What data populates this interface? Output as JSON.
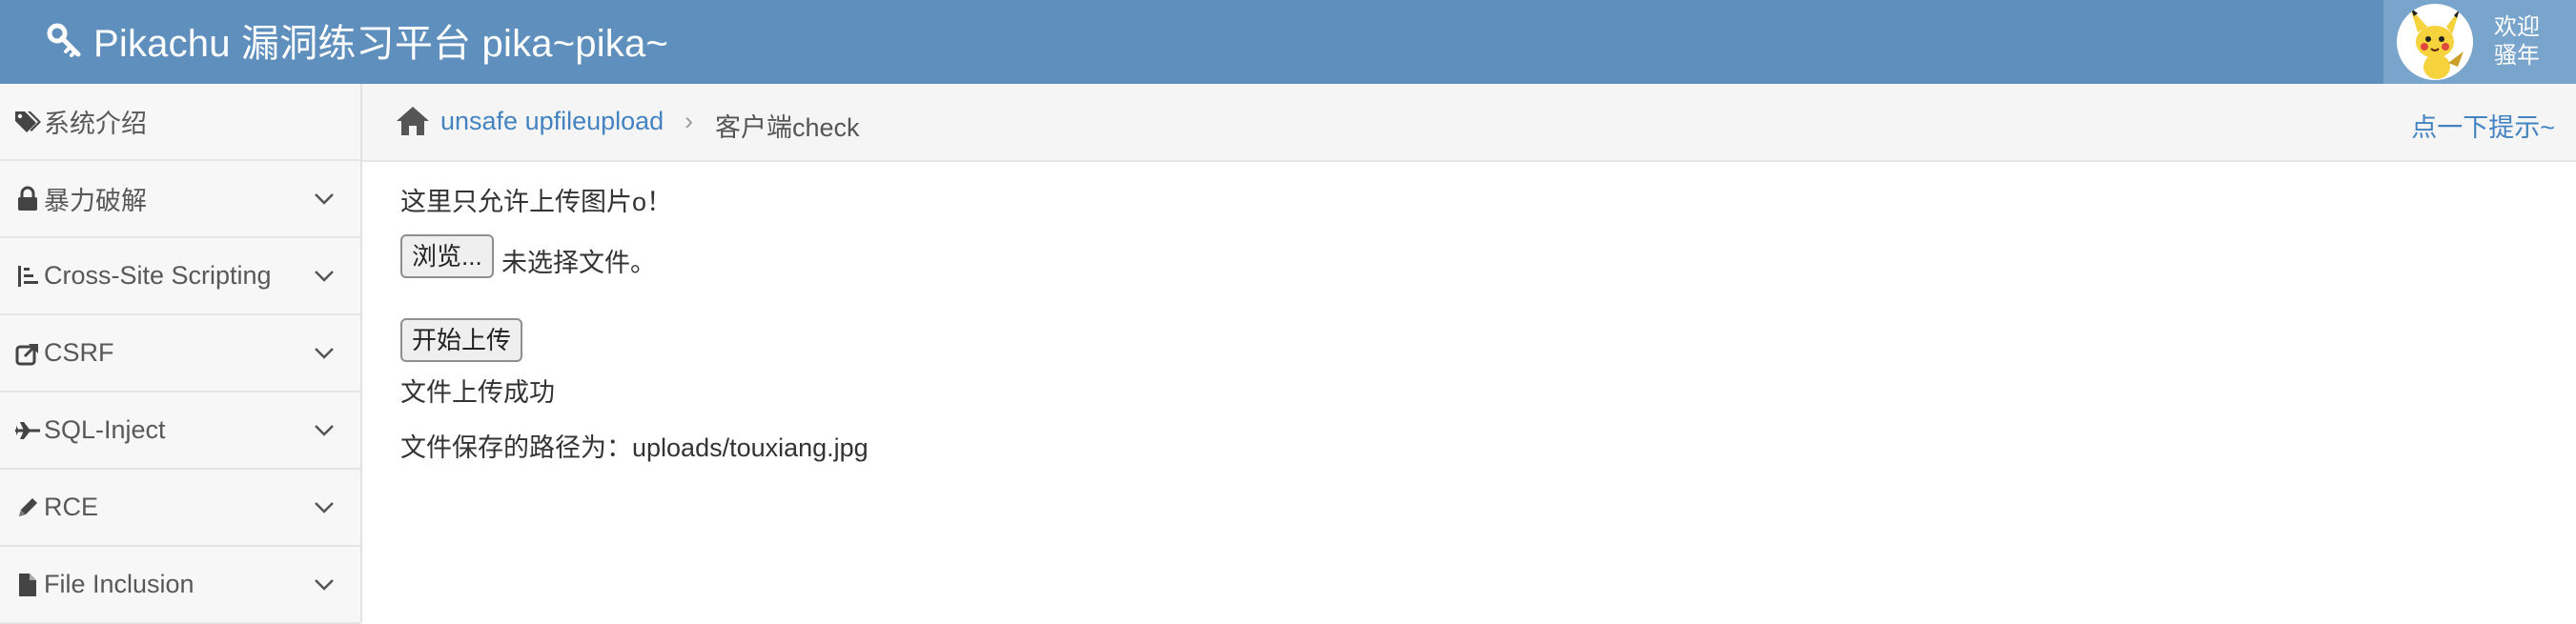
{
  "header": {
    "title": "Pikachu 漏洞练习平台 pika~pika~",
    "welcome_line1": "欢迎",
    "welcome_line2": "骚年"
  },
  "sidebar": {
    "items": [
      {
        "label": "系统介绍",
        "icon": "tags-icon",
        "expandable": false
      },
      {
        "label": "暴力破解",
        "icon": "lock-icon",
        "expandable": true
      },
      {
        "label": "Cross-Site Scripting",
        "icon": "list-icon",
        "expandable": true
      },
      {
        "label": "CSRF",
        "icon": "share-icon",
        "expandable": true
      },
      {
        "label": "SQL-Inject",
        "icon": "plane-icon",
        "expandable": true
      },
      {
        "label": "RCE",
        "icon": "pencil-icon",
        "expandable": true
      },
      {
        "label": "File Inclusion",
        "icon": "file-icon",
        "expandable": true
      }
    ]
  },
  "breadcrumb": {
    "link": "unsafe upfileupload",
    "separator": "›",
    "current": "客户端check",
    "hint": "点一下提示~"
  },
  "main": {
    "notice": "这里只允许上传图片o！",
    "browse_label": "浏览...",
    "no_file_text": "未选择文件。",
    "upload_label": "开始上传",
    "success_text": "文件上传成功",
    "path_text": "文件保存的路径为：uploads/touxiang.jpg"
  },
  "colors": {
    "navbar": "#5e8fbd",
    "user_box": "#79a5cd",
    "link": "#4383c2",
    "sidebar_bg": "#f7f7f7"
  }
}
